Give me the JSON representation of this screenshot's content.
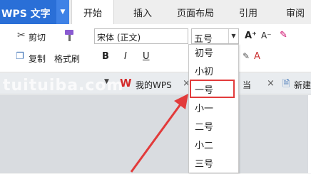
{
  "app": {
    "title": "WPS 文字",
    "menu_arrow": "▼"
  },
  "tabs": [
    {
      "label": "开始",
      "active": true
    },
    {
      "label": "插入"
    },
    {
      "label": "页面布局"
    },
    {
      "label": "引用"
    },
    {
      "label": "审阅"
    }
  ],
  "ribbon": {
    "cut": "剪切",
    "copy": "复制",
    "format_painter": "格式刷",
    "font_name": "宋体 (正文)",
    "font_size": "五号",
    "bold": "B",
    "italic": "I",
    "underline": "U",
    "grow_font": "A⁺",
    "shrink_font": "A⁻"
  },
  "doc_tabs": {
    "my_wps": "我的WPS",
    "new_doc": "新建",
    "partial": "当"
  },
  "font_size_options": [
    "初号",
    "小初",
    "一号",
    "小一",
    "二号",
    "小二",
    "三号"
  ],
  "highlighted_option": "一号",
  "watermark": "tuituiba.com",
  "colors": {
    "accent": "#2a6fd7",
    "highlight_box": "#e23b3b",
    "arrow": "#e23b3b"
  }
}
